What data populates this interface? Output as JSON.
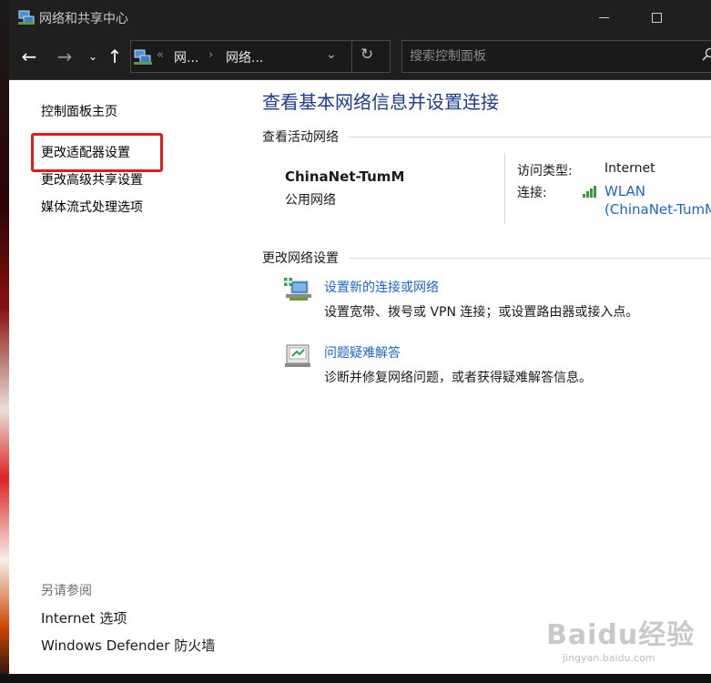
{
  "window": {
    "title": "网络和共享中心",
    "minimize_icon": "minimize-icon",
    "maximize_icon": "maximize-icon"
  },
  "nav": {
    "back_icon": "arrow-left-icon",
    "forward_icon": "arrow-right-icon",
    "up_icon": "arrow-up-icon",
    "breadcrumb": [
      "网...",
      "网络..."
    ],
    "search_placeholder": "搜索控制面板"
  },
  "sidebar": {
    "items": [
      {
        "label": "控制面板主页"
      },
      {
        "label": "更改适配器设置"
      },
      {
        "label": "更改高级共享设置"
      },
      {
        "label": "媒体流式处理选项"
      }
    ],
    "see_also_title": "另请参阅",
    "see_also": [
      {
        "label": "Internet 选项"
      },
      {
        "label": "Windows Defender 防火墙"
      }
    ]
  },
  "main": {
    "heading": "查看基本网络信息并设置连接",
    "active_section": "查看活动网络",
    "network": {
      "name": "ChinaNet-TumM",
      "type": "公用网络",
      "access_label": "访问类型:",
      "access_value": "Internet",
      "conn_label": "连接:",
      "conn_line1": "WLAN",
      "conn_line2": "(ChinaNet-TumM"
    },
    "change_section": "更改网络设置",
    "tasks": [
      {
        "title": "设置新的连接或网络",
        "desc": "设置宽带、拨号或 VPN 连接；或设置路由器或接入点。",
        "icon": "network-setup-icon"
      },
      {
        "title": "问题疑难解答",
        "desc": "诊断并修复网络问题，或者获得疑难解答信息。",
        "icon": "troubleshoot-icon"
      }
    ]
  },
  "watermark": {
    "main": "Baidu经验",
    "sub": "jingyan.baidu.com"
  },
  "colors": {
    "link": "#1a66c8",
    "heading": "#1e3a8a",
    "highlight": "#e21c1c",
    "titlebar": "#1f1f1f"
  }
}
